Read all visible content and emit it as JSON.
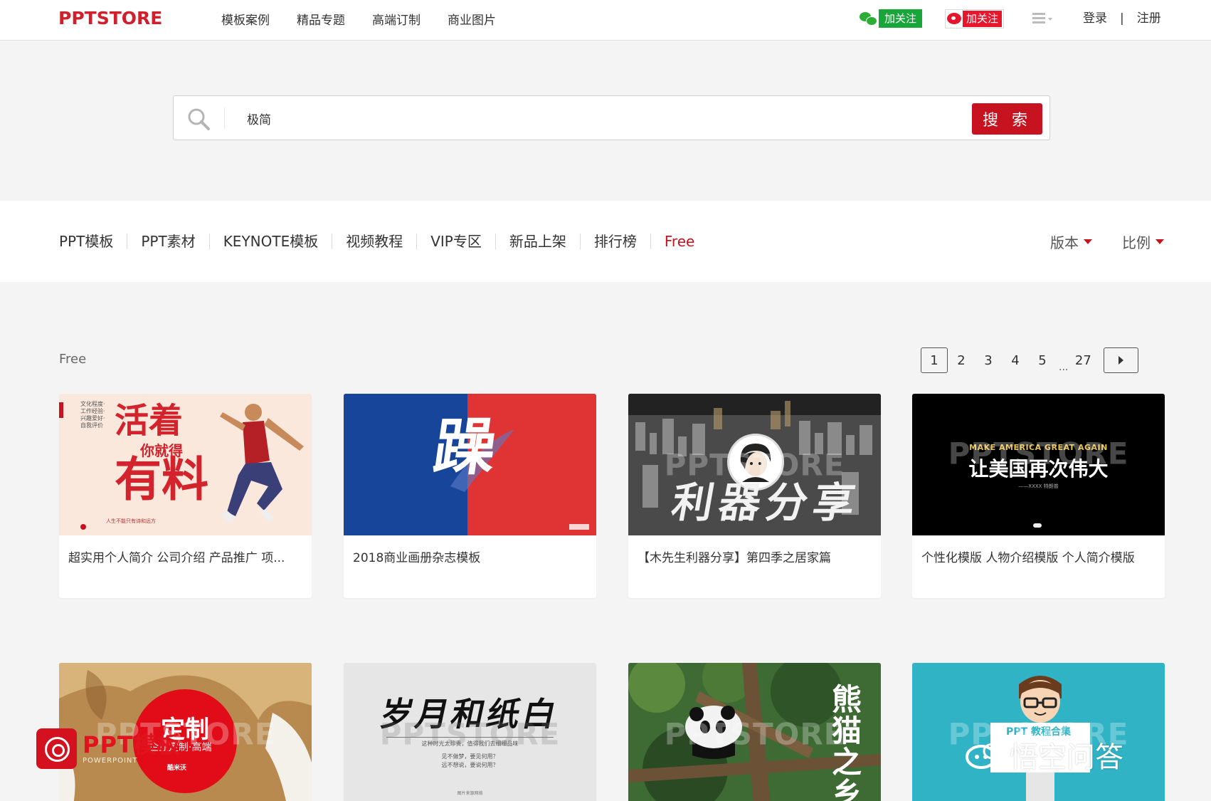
{
  "header": {
    "logo": "PPTSTORE",
    "nav": [
      "模板案例",
      "精品专题",
      "高端订制",
      "商业图片"
    ],
    "wechat_follow": "加关注",
    "weibo_follow": "加关注",
    "login": "登录",
    "divider": "|",
    "register": "注册"
  },
  "search": {
    "value": "极简",
    "button": "搜 索"
  },
  "categories": {
    "items": [
      "PPT模板",
      "PPT素材",
      "KEYNOTE模板",
      "视频教程",
      "VIP专区",
      "新品上架",
      "排行榜",
      "Free"
    ],
    "active": "Free",
    "filters": [
      "版本",
      "比例"
    ]
  },
  "section": {
    "title": "Free"
  },
  "pagination": {
    "pages": [
      "1",
      "2",
      "3",
      "4",
      "5"
    ],
    "dots": "...",
    "last": "27",
    "current": "1"
  },
  "cards": [
    {
      "title": "超实用个人简介 公司介绍 产品推广 项...",
      "thumb": {
        "line1": "活着",
        "line2": "你就得",
        "line3": "有料",
        "side": "文化程度·工作经验·兴趣爱好·自我评价",
        "sub": "人生不能只有诗和远方"
      }
    },
    {
      "title": "2018商业画册杂志模板",
      "thumb": {
        "char": "躁"
      }
    },
    {
      "title": "【木先生利器分享】第四季之居家篇",
      "thumb": {
        "text": "利器分享"
      }
    },
    {
      "title": "个性化模版 人物介绍模版 个人简介模版",
      "thumb": {
        "eng": "MAKE AMERICA GREAT AGAIN",
        "cn": "让美国再次伟大",
        "sub": "——XXXX 特朗普"
      }
    },
    {
      "title": "",
      "thumb": {
        "text": "定制",
        "sub": "企业定制·高端",
        "logo": "酷米沃"
      }
    },
    {
      "title": "",
      "thumb": {
        "title": "岁月和纸白",
        "line1": "这种时光太珍贵，值得我们去细细品味",
        "line2": "见不做梦，要见何用？",
        "line3": "远不想说，要说何用？",
        "footer": "图片来源网络"
      }
    },
    {
      "title": "",
      "thumb": {
        "text": "熊猫之乡"
      }
    },
    {
      "title": "",
      "thumb": {
        "text": "PPT 教程合集"
      }
    }
  ],
  "watermark": "PPTSTORE",
  "overlay": {
    "brand": "PPT模板",
    "brand_sub": "POWERPOINT",
    "toutiao": "悟空问答"
  },
  "colors": {
    "brand_red": "#c7131f",
    "wechat_green": "#18a53a",
    "weibo_red": "#e6162d",
    "page_bg": "#f4f4f4"
  },
  "icons": [
    "wechat-icon",
    "weibo-icon",
    "menu-list-icon",
    "search-icon",
    "caret-down-icon",
    "next-arrow-icon"
  ]
}
